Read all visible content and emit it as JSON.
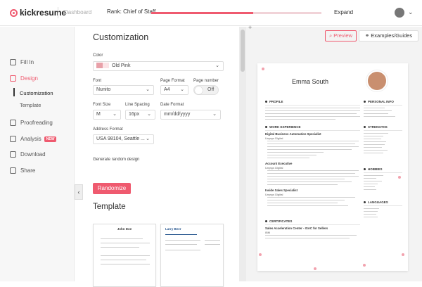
{
  "topbar": {
    "logo": "kickresume",
    "dashboard": "Dashboard",
    "rank": "Rank: Chief of Staff",
    "rank_progress": 0.6,
    "expand": "Expand"
  },
  "nav": {
    "fill_in": "Fill In",
    "design": "Design",
    "customization": "Customization",
    "template": "Template",
    "proofreading": "Proofreading",
    "analysis": "Analysis",
    "new_badge": "NEW",
    "download": "Download",
    "share": "Share"
  },
  "customization": {
    "title": "Customization",
    "color_label": "Color",
    "color_value": "Old Pink",
    "font_label": "Font",
    "font_value": "Nunito",
    "page_format_label": "Page Format",
    "page_format_value": "A4",
    "page_number_label": "Page number",
    "page_number_value": "Off",
    "font_size_label": "Font Size",
    "font_size_value": "M",
    "line_spacing_label": "Line Spacing",
    "line_spacing_value": "16px",
    "date_format_label": "Date Format",
    "date_format_value": "mm/dd/yyyy",
    "address_format_label": "Address Format",
    "address_format_value": "USA 98104, Seattle ...",
    "random_label": "Generate random design",
    "randomize": "Randomize"
  },
  "template_section": {
    "title": "Template",
    "templates": [
      "John Doe",
      "Larry Beer"
    ]
  },
  "preview": {
    "preview_btn": "Preview",
    "examples_btn": "Examples/Guides"
  },
  "resume": {
    "name": "Emma South",
    "sections": {
      "profile": "PROFILE",
      "experience": "WORK EXPERIENCE",
      "certificates": "CERTIFICATES",
      "personal_info": "PERSONAL INFO",
      "strengths": "STRENGTHS",
      "hobbies": "HOBBIES",
      "languages": "LANGUAGES"
    },
    "jobs": [
      {
        "title": "Digital Business Automation Specialist",
        "company": "Unysys Digital"
      },
      {
        "title": "Account Executive",
        "company": "Unysys Digital"
      },
      {
        "title": "Inside Sales Specialist",
        "company": "Unysys Digital"
      }
    ],
    "certificate": "Sales Acceleration Center - ISAC for Sellers",
    "certificate_org": "IBM"
  },
  "colors": {
    "accent": "#ef5a6f"
  }
}
